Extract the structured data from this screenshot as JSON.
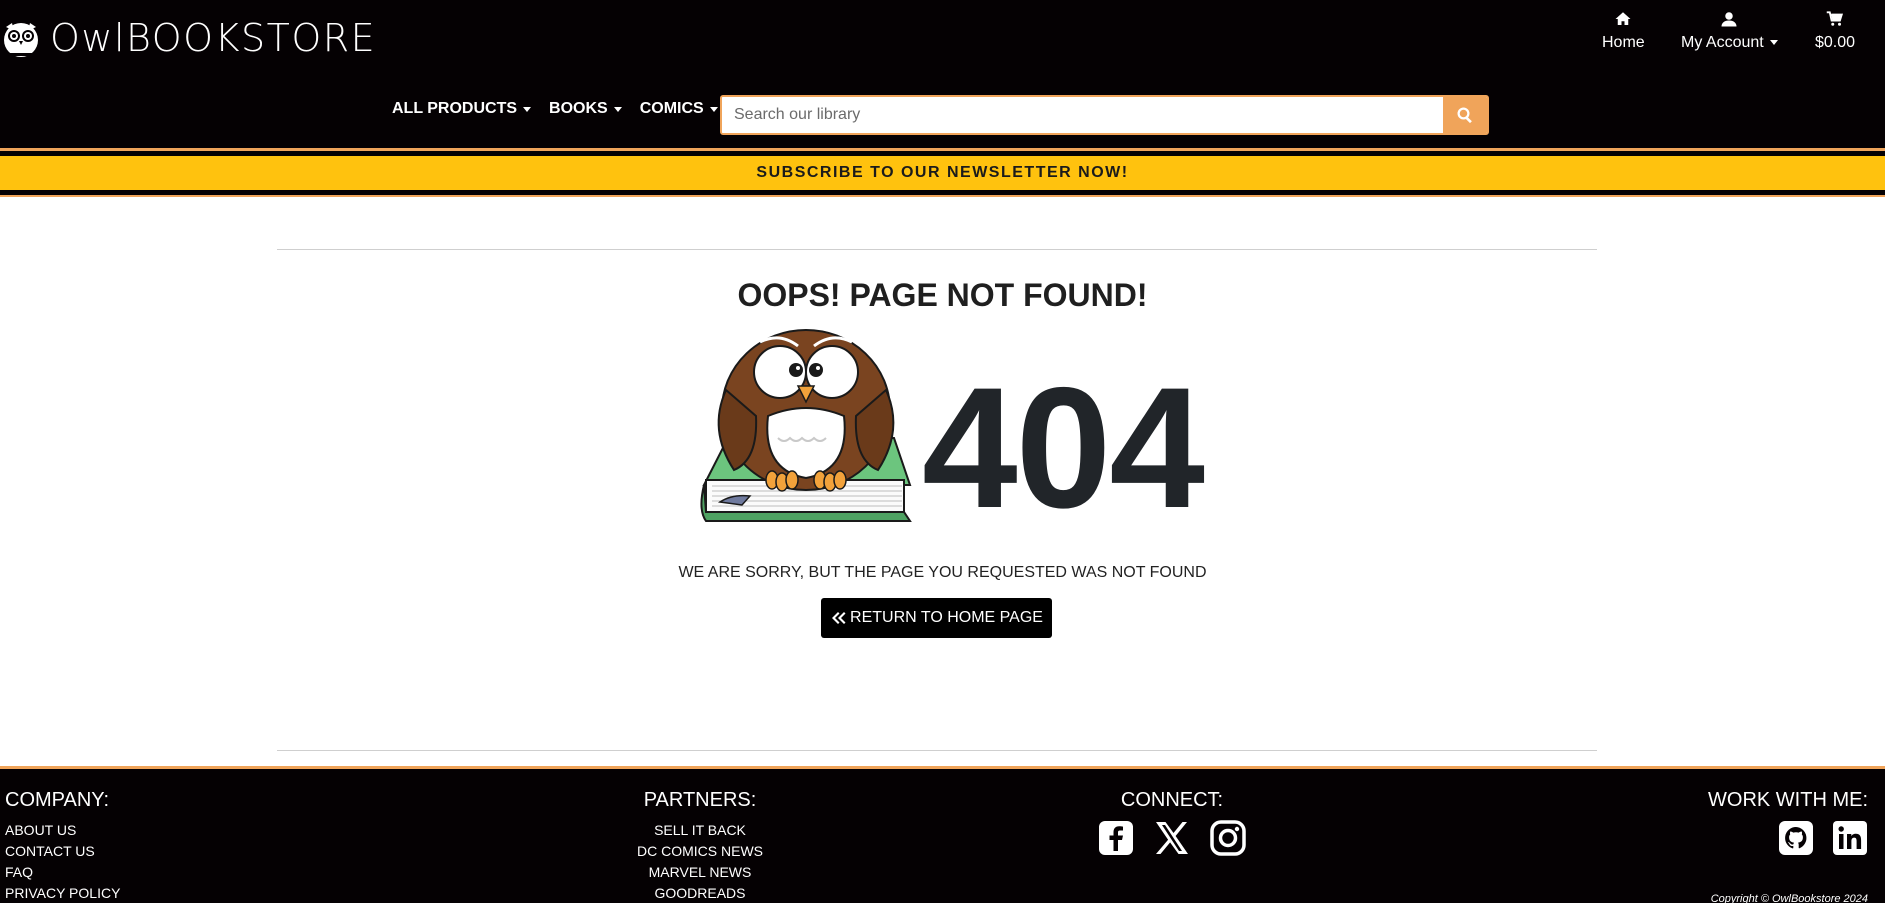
{
  "brand": {
    "name": "OwlBOOKSTORE",
    "name_prefix": "Owl",
    "name_suffix": "BOOKSTORE"
  },
  "utility_nav": {
    "home": "Home",
    "account": "My Account",
    "cart_total": "$0.00"
  },
  "main_nav": {
    "items": [
      {
        "label": "ALL PRODUCTS"
      },
      {
        "label": "BOOKS"
      },
      {
        "label": "COMICS"
      }
    ]
  },
  "search": {
    "placeholder": "Search our library",
    "value": ""
  },
  "banner": {
    "text": "SUBSCRIBE TO OUR NEWSLETTER NOW!"
  },
  "error_page": {
    "title": "OOPS! PAGE NOT FOUND!",
    "code": "404",
    "message": "WE ARE SORRY, BUT THE PAGE YOU REQUESTED WAS NOT FOUND",
    "button_label": "RETURN TO HOME PAGE"
  },
  "footer": {
    "company": {
      "heading": "COMPANY:",
      "links": [
        "ABOUT US",
        "CONTACT US",
        "FAQ",
        "PRIVACY POLICY"
      ]
    },
    "partners": {
      "heading": "PARTNERS:",
      "links": [
        "SELL IT BACK",
        "DC COMICS NEWS",
        "MARVEL NEWS",
        "GOODREADS"
      ]
    },
    "connect": {
      "heading": "CONNECT:",
      "icons": [
        "facebook-icon",
        "x-twitter-icon",
        "instagram-icon"
      ]
    },
    "work_with_me": {
      "heading": "WORK WITH ME:",
      "icons": [
        "github-icon",
        "linkedin-icon"
      ]
    },
    "copyright": "Copyright © OwlBookstore 2024"
  },
  "colors": {
    "header_bg": "#050103",
    "accent_orange": "#f0a45a",
    "banner_yellow": "#ffc20e"
  }
}
